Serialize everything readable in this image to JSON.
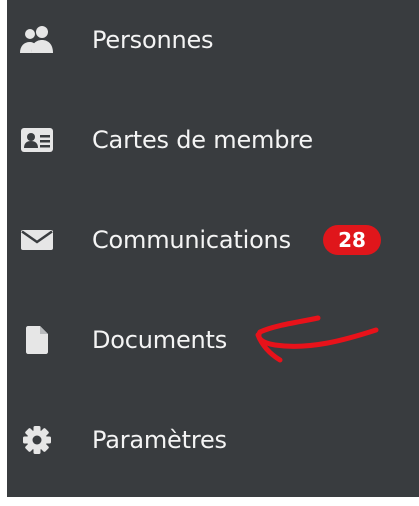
{
  "colors": {
    "sidebar_bg": "#393c3f",
    "text": "#f4f4f4",
    "icon": "#e6e6e6",
    "badge_bg": "#e0161b",
    "annotation": "#e8121a"
  },
  "menu": {
    "items": [
      {
        "label": "Personnes",
        "icon": "users-icon"
      },
      {
        "label": "Cartes de membre",
        "icon": "id-card-icon"
      },
      {
        "label": "Communications",
        "icon": "envelope-icon",
        "badge": "28"
      },
      {
        "label": "Documents",
        "icon": "file-icon"
      },
      {
        "label": "Paramètres",
        "icon": "gear-icon"
      }
    ]
  }
}
